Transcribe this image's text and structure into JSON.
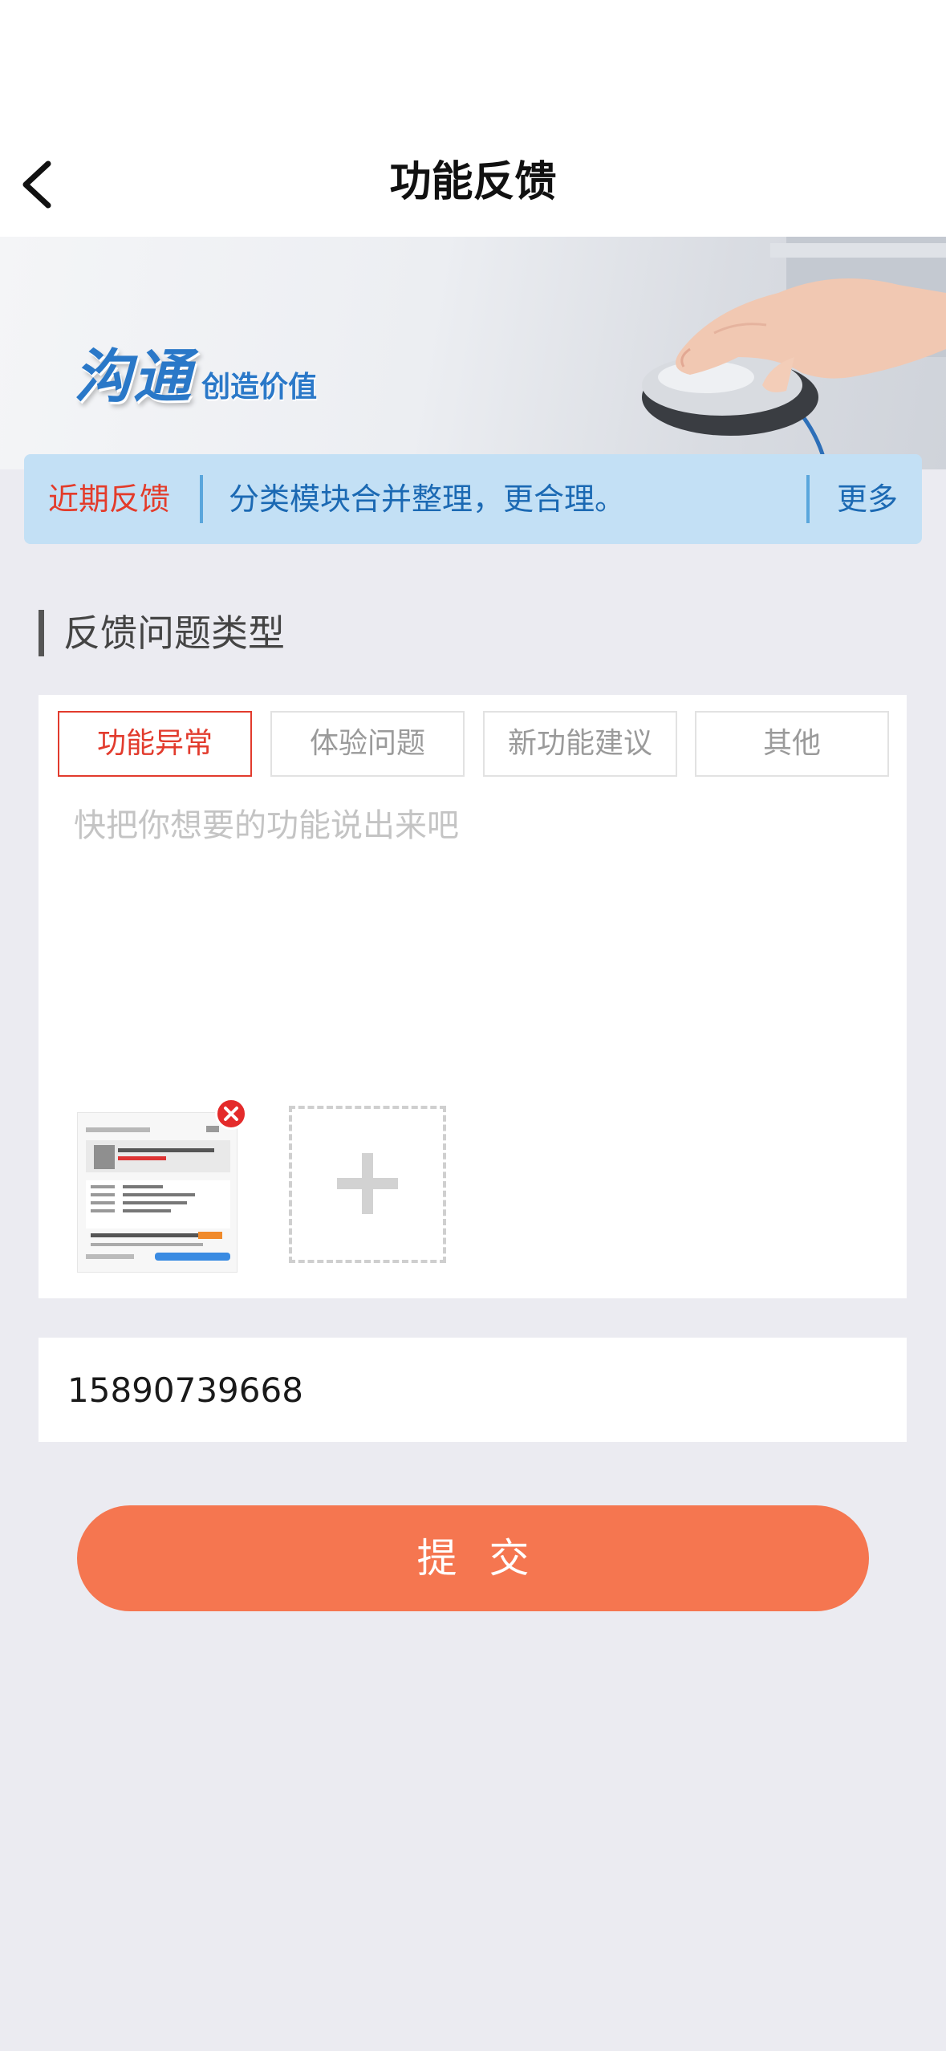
{
  "header": {
    "title": "功能反馈",
    "back_icon": "chevron-left-icon"
  },
  "banner": {
    "logo_main": "沟通",
    "logo_sub": "创造价值"
  },
  "notice": {
    "label": "近期反馈",
    "text": "分类模块合并整理，更合理。",
    "more": "更多"
  },
  "section": {
    "title": "反馈问题类型"
  },
  "feedback_types": [
    {
      "label": "功能异常",
      "selected": true
    },
    {
      "label": "体验问题",
      "selected": false
    },
    {
      "label": "新功能建议",
      "selected": false
    },
    {
      "label": "其他",
      "selected": false
    }
  ],
  "feedback": {
    "placeholder": "快把你想要的功能说出来吧",
    "value": ""
  },
  "attachments": {
    "remove_icon": "close-icon",
    "add_icon": "plus-icon"
  },
  "contact": {
    "phone": "15890739668"
  },
  "submit_label": "提交",
  "colors": {
    "accent_red": "#e23b2d",
    "notice_bg": "#c3e0f5",
    "notice_text": "#1b69b3",
    "submit_bg": "#f57650",
    "page_bg": "#ebebf1"
  }
}
